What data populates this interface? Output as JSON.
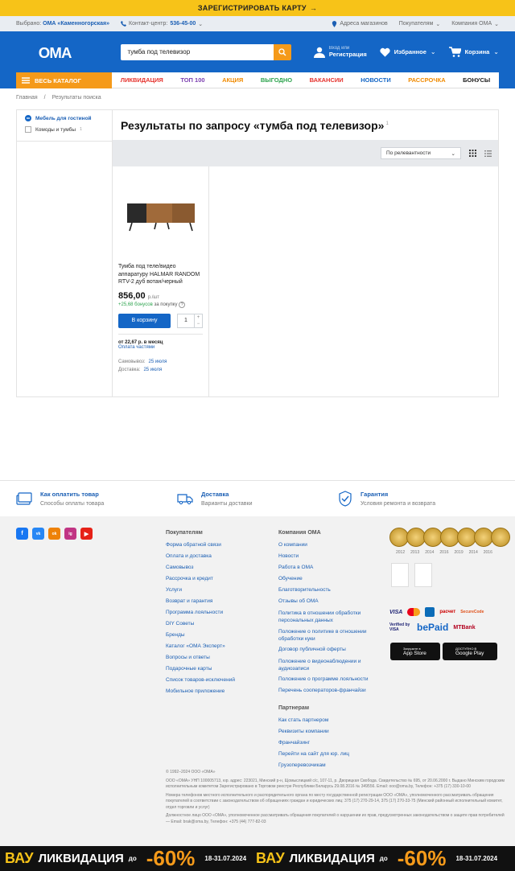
{
  "promo": {
    "text": "ЗАРЕГИСТРИРОВАТЬ КАРТУ",
    "arrow": "→"
  },
  "topbar": {
    "selected_prefix": "Выбрано:",
    "selected_store": "ОМА «Каменногорская»",
    "contact_prefix": "Контакт-центр:",
    "contact_phone": "536-45-00",
    "stores": "Адреса магазинов",
    "buyers": "Покупателям",
    "company": "Компания ОМА"
  },
  "header": {
    "logo": "ОМА",
    "search_value": "тумба под телевизор",
    "login_small": "Вход или",
    "login_big": "Регистрация",
    "favorites": "Избранное",
    "cart": "Корзина"
  },
  "nav": {
    "catalog": "ВЕСЬ КАТАЛОГ",
    "items": [
      {
        "label": "ЛИКВИДАЦИЯ",
        "color": "#e5322d"
      },
      {
        "label": "ТОП 100",
        "color": "#7b3fb0"
      },
      {
        "label": "АКЦИЯ",
        "color": "#f08a00"
      },
      {
        "label": "ВЫГОДНО",
        "color": "#2ea44f"
      },
      {
        "label": "ВАКАНСИИ",
        "color": "#e5322d"
      },
      {
        "label": "НОВОСТИ",
        "color": "#1466c6"
      },
      {
        "label": "РАССРОЧКА",
        "color": "#f08a00"
      },
      {
        "label": "БОНУСЫ",
        "color": "#222222"
      }
    ]
  },
  "breadcrumbs": [
    "Главная",
    "Результаты поиска"
  ],
  "filters": {
    "active": "Мебель для гостиной",
    "item": "Комоды и тумбы",
    "item_count": "1"
  },
  "results": {
    "title": "Результаты по запросу «тумба под телевизор»",
    "count": "1",
    "sort": "По релевантности"
  },
  "product": {
    "name": "Тумба под теле/видео аппаратуру HALMAR RANDOM RTV-2 дуб вотан/черный",
    "price": "856,00",
    "unit": "р./шт",
    "bonus": "+25,68 бонусов",
    "bonus_suffix": "за покупку",
    "button": "В корзину",
    "qty": "1",
    "credit": "от 22,67 р. в месяц",
    "credit_link": "Оплата частями",
    "pickup_label": "Самовывоз:",
    "pickup_date": "25 июля",
    "delivery_label": "Доставка:",
    "delivery_date": "25 июля"
  },
  "features": [
    {
      "title": "Как оплатить товар",
      "sub": "Способы оплаты товара"
    },
    {
      "title": "Доставка",
      "sub": "Варианты доставки"
    },
    {
      "title": "Гарантия",
      "sub": "Условия ремонта и возврата"
    }
  ],
  "footer": {
    "social": [
      "f",
      "vk",
      "ok",
      "ig",
      "▶"
    ],
    "buyers_title": "Покупателям",
    "buyers": [
      "Форма обратной связи",
      "Оплата и доставка",
      "Самовывоз",
      "Рассрочка и кредит",
      "Услуги",
      "Возврат и гарантия",
      "Программа лояльности",
      "DIY Советы",
      "Бренды",
      "Каталог «ОМА Эксперт»",
      "Вопросы и ответы",
      "Подарочные карты",
      "Список товаров-исключений",
      "Мобильное приложение"
    ],
    "company_title": "Компания ОМА",
    "company": [
      "О компании",
      "Новости",
      "Работа в ОМА",
      "Обучение",
      "Благотворительность",
      "Отзывы об ОМА",
      "Политика в отношении обработки персональных данных",
      "Положение о политике в отношении обработки куки",
      "Договор публичной оферты",
      "Положение о видеонаблюдении и аудиозаписи",
      "Положение о программе лояльности",
      "Перечень сооператоров-франчайзи"
    ],
    "partners_title": "Партнерам",
    "partners": [
      "Как стать партнером",
      "Реквизиты компании",
      "Франчайзинг",
      "Перейти на сайт для юр. лиц",
      "Грузоперевозчикам"
    ],
    "years": [
      "2012",
      "2013",
      "2014",
      "2016",
      "2019",
      "2014",
      "2016"
    ],
    "payments": [
      "VISA",
      "MasterCard",
      "БЕЛКАРТ",
      "расчет",
      "SecureCode",
      "Verified by VISA",
      "bePaid",
      "MTBank"
    ],
    "appstore_small": "Загрузите в",
    "appstore": "App Store",
    "gplay_small": "ДОСТУПНО В",
    "gplay": "Google Play",
    "legal": [
      "© 1992–2024 ООО «ОМА»",
      "ООО «ОМА» УНП 100005713, юр. адрес: 223021, Минский р-н, Щомыслицкий с/с, 107-11, р. Дворицкая Свобода. Свидетельство № 695, от 20.06.2000 г. Выдано Минским городским исполнительным комитетом Зарегистрировано в Торговом реестре Республики Беларусь 29.08.2016 № 349556. Email: ooo@oma.by, Телефон: +375 (17) 330-10-00",
      "Номера телефонов местного исполнительного и распорядительного органа по месту государственной регистрации ООО «ОМА», уполномоченного рассматривать обращения покупателей в соответствии с законодательством об обращениях граждан и юридических лиц: 375 (17) 270-29-14, 375 (17) 270-33-75 (Минский районный исполнительный комитет, отдел торговли и услуг)",
      "Должностное лицо ООО «ОМА», уполномоченное рассматривать обращения покупателей о нарушении их прав, предусмотренных законодательством о защите прав потребителей — Email: brak@oma.by, Телефон: +375 (44) 777-82-03"
    ]
  },
  "banner": {
    "wow": "ВАУ",
    "liq": "ЛИКВИДАЦИЯ",
    "upto": "до",
    "pct": "-60%",
    "dates": "18-31.07.2024",
    "close": "×"
  }
}
